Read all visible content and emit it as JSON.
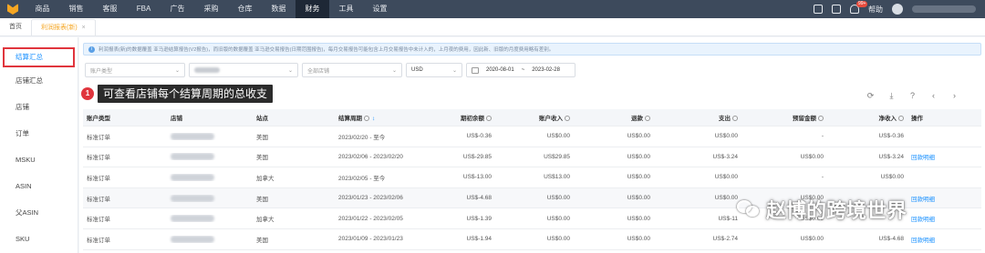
{
  "topnav": {
    "items": [
      "商品",
      "销售",
      "客服",
      "FBA",
      "广告",
      "采购",
      "仓库",
      "数据",
      "财务",
      "工具",
      "设置"
    ],
    "active_index": 8,
    "help": "帮助",
    "badge": "99+"
  },
  "tabs": {
    "home": "首页",
    "current": "利润报表(新)",
    "close": "×"
  },
  "sidebar": {
    "items": [
      "结算汇总",
      "店铺汇总",
      "店铺",
      "订单",
      "MSKU",
      "ASIN",
      "父ASIN",
      "SKU"
    ]
  },
  "notice": {
    "text": "利润报表(新)的数据覆盖 亚马逊结算报告(V2报告)，而旧版的数据覆盖 亚马逊交易报告(日期范围报告)，每月交易报告可能包含上月交易报告中未计入的，上月夜的费用，因此新、旧版的月度费用略有差别。"
  },
  "filters": {
    "account_type": "账户类型",
    "all_shops": "全部店铺",
    "currency": "USD",
    "date_start": "2020-08-01",
    "date_sep": "~",
    "date_end": "2023-02-28"
  },
  "callout": {
    "number": "1",
    "text": "可查看店铺每个结算周期的总收支"
  },
  "table": {
    "headers": [
      "账户类型",
      "店铺",
      "站点",
      "结算周期",
      "期初余额",
      "账户收入",
      "退款",
      "支出",
      "预留金额",
      "净收入",
      "操作"
    ],
    "rows": [
      [
        "标准订单",
        "",
        "美国",
        "2023/02/20 - 至今",
        "US$-0.36",
        "US$0.00",
        "US$0.00",
        "US$0.00",
        "-",
        "US$-0.36",
        ""
      ],
      [
        "标准订单",
        "",
        "美国",
        "2023/02/06 - 2023/02/20",
        "US$-29.85",
        "US$29.85",
        "US$0.00",
        "US$-3.24",
        "US$0.00",
        "US$-3.24",
        "回款明细"
      ],
      [
        "标准订单",
        "",
        "加拿大",
        "2023/02/05 - 至今",
        "US$-13.00",
        "US$13.00",
        "US$0.00",
        "US$0.00",
        "-",
        "US$0.00",
        ""
      ],
      [
        "标准订单",
        "",
        "美国",
        "2023/01/23 - 2023/02/06",
        "US$-4.68",
        "US$0.00",
        "US$0.00",
        "US$0.00",
        "US$0.00",
        "",
        "回款明细"
      ],
      [
        "标准订单",
        "",
        "加拿大",
        "2023/01/22 - 2023/02/05",
        "US$-1.39",
        "US$0.00",
        "US$0.00",
        "US$-11",
        "US$0.00",
        "",
        "回款明细"
      ],
      [
        "标准订单",
        "",
        "美国",
        "2023/01/09 - 2023/01/23",
        "US$-1.94",
        "US$0.00",
        "US$0.00",
        "US$-2.74",
        "US$0.00",
        "US$-4.68",
        "回款明细"
      ]
    ]
  },
  "watermark": {
    "text": "赵博的跨境世界"
  },
  "colors": {
    "topbar": "#3d4a5c",
    "accent": "#1890ff",
    "highlight": "#e0353d",
    "tab_active": "#f5a623"
  }
}
